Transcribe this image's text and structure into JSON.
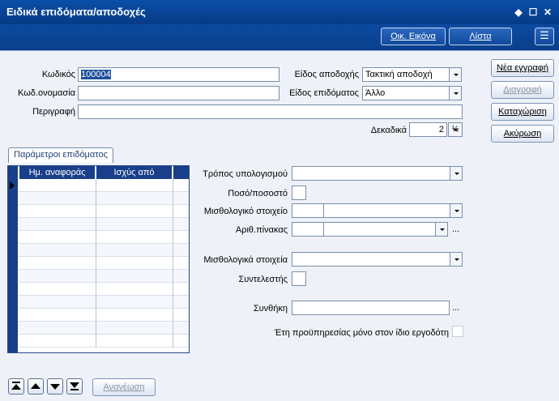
{
  "window": {
    "title": "Ειδικά επιδόματα/αποδοχές"
  },
  "toolbar": {
    "home_label": "Οικ. Εικόνα",
    "list_label": "Λίστα"
  },
  "form": {
    "code_label": "Κωδικός",
    "code_value": "100004",
    "codename_label": "Κωδ.ονομασία",
    "codename_value": "",
    "description_label": "Περιγραφή",
    "description_value": "",
    "earning_type_label": "Είδος αποδοχής",
    "earning_type_value": "Τακτική αποδοχή",
    "allowance_type_label": "Είδος επιδόματος",
    "allowance_type_value": "Άλλο",
    "decimals_label": "Δεκαδικά",
    "decimals_value": "2",
    "decimals_unit": "½"
  },
  "actions": {
    "new_label": "Νέα εγγραφή",
    "delete_label": "Διαγραφή",
    "save_label": "Καταχώριση",
    "cancel_label": "Ακύρωση"
  },
  "params": {
    "tab_label": "Παράμετροι επιδόματος",
    "columns": [
      "Ημ. αναφοράς",
      "Ισχύς από"
    ],
    "calc_method_label": "Τρόπος υπολογισμού",
    "amount_pct_label": "Ποσό/ποσοστό",
    "payroll_item_label": "Μισθολογικό στοιχείο",
    "table_no_label": "Αριθ.πίνακας",
    "payroll_items_label": "Μισθολογικά στοιχεία",
    "coefficient_label": "Συντελεστής",
    "condition_label": "Συνθήκη",
    "seniority_label": "Έτη προϋπηρεσίας μόνο στον ίδιο εργοδότη",
    "ellipsis": "..."
  },
  "footer": {
    "refresh_label": "Ανανέωση"
  }
}
